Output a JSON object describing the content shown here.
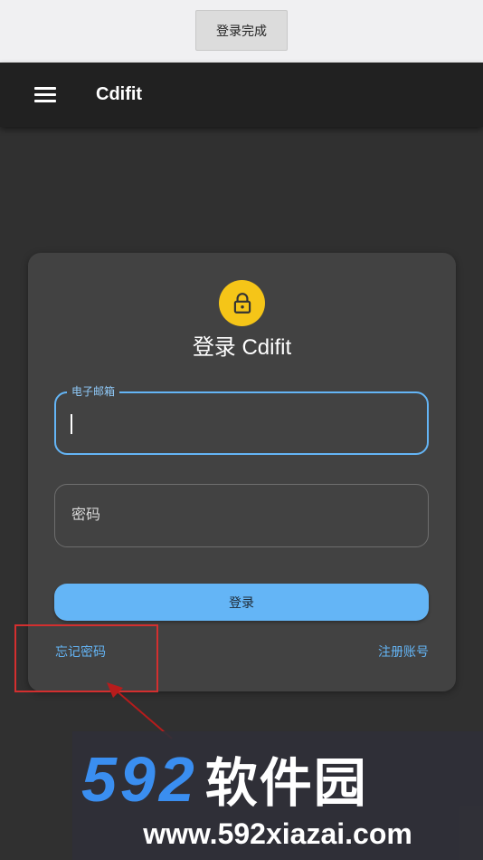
{
  "top_bar": {
    "done_label": "登录完成"
  },
  "app_bar": {
    "title": "Cdifit"
  },
  "card": {
    "title": "登录 Cdifit",
    "email_label": "电子邮箱",
    "password_label": "密码",
    "login_label": "登录",
    "forgot_label": "忘记密码",
    "register_label": "注册账号"
  },
  "watermark": {
    "brand_digits": "592",
    "brand_text": "软件园",
    "url": "www.592xiazai.com"
  },
  "colors": {
    "accent": "#64b5f6",
    "lock_avatar": "#f5c518",
    "card": "#424242",
    "background": "#303030",
    "app_bar": "#212121",
    "highlight": "#d32f2f"
  },
  "icons": {
    "menu": "menu-icon",
    "lock": "lock-icon",
    "annotation": "arrow-icon"
  }
}
